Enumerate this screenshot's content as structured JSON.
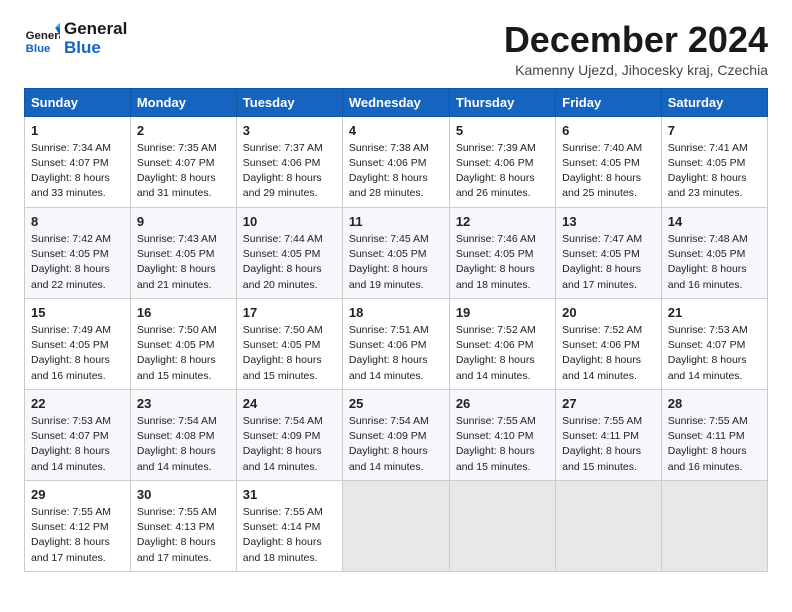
{
  "logo": {
    "line1": "General",
    "line2": "Blue"
  },
  "title": "December 2024",
  "subtitle": "Kamenny Ujezd, Jihocesky kraj, Czechia",
  "weekdays": [
    "Sunday",
    "Monday",
    "Tuesday",
    "Wednesday",
    "Thursday",
    "Friday",
    "Saturday"
  ],
  "weeks": [
    [
      {
        "day": 1,
        "sunrise": "Sunrise: 7:34 AM",
        "sunset": "Sunset: 4:07 PM",
        "daylight": "Daylight: 8 hours and 33 minutes."
      },
      {
        "day": 2,
        "sunrise": "Sunrise: 7:35 AM",
        "sunset": "Sunset: 4:07 PM",
        "daylight": "Daylight: 8 hours and 31 minutes."
      },
      {
        "day": 3,
        "sunrise": "Sunrise: 7:37 AM",
        "sunset": "Sunset: 4:06 PM",
        "daylight": "Daylight: 8 hours and 29 minutes."
      },
      {
        "day": 4,
        "sunrise": "Sunrise: 7:38 AM",
        "sunset": "Sunset: 4:06 PM",
        "daylight": "Daylight: 8 hours and 28 minutes."
      },
      {
        "day": 5,
        "sunrise": "Sunrise: 7:39 AM",
        "sunset": "Sunset: 4:06 PM",
        "daylight": "Daylight: 8 hours and 26 minutes."
      },
      {
        "day": 6,
        "sunrise": "Sunrise: 7:40 AM",
        "sunset": "Sunset: 4:05 PM",
        "daylight": "Daylight: 8 hours and 25 minutes."
      },
      {
        "day": 7,
        "sunrise": "Sunrise: 7:41 AM",
        "sunset": "Sunset: 4:05 PM",
        "daylight": "Daylight: 8 hours and 23 minutes."
      }
    ],
    [
      {
        "day": 8,
        "sunrise": "Sunrise: 7:42 AM",
        "sunset": "Sunset: 4:05 PM",
        "daylight": "Daylight: 8 hours and 22 minutes."
      },
      {
        "day": 9,
        "sunrise": "Sunrise: 7:43 AM",
        "sunset": "Sunset: 4:05 PM",
        "daylight": "Daylight: 8 hours and 21 minutes."
      },
      {
        "day": 10,
        "sunrise": "Sunrise: 7:44 AM",
        "sunset": "Sunset: 4:05 PM",
        "daylight": "Daylight: 8 hours and 20 minutes."
      },
      {
        "day": 11,
        "sunrise": "Sunrise: 7:45 AM",
        "sunset": "Sunset: 4:05 PM",
        "daylight": "Daylight: 8 hours and 19 minutes."
      },
      {
        "day": 12,
        "sunrise": "Sunrise: 7:46 AM",
        "sunset": "Sunset: 4:05 PM",
        "daylight": "Daylight: 8 hours and 18 minutes."
      },
      {
        "day": 13,
        "sunrise": "Sunrise: 7:47 AM",
        "sunset": "Sunset: 4:05 PM",
        "daylight": "Daylight: 8 hours and 17 minutes."
      },
      {
        "day": 14,
        "sunrise": "Sunrise: 7:48 AM",
        "sunset": "Sunset: 4:05 PM",
        "daylight": "Daylight: 8 hours and 16 minutes."
      }
    ],
    [
      {
        "day": 15,
        "sunrise": "Sunrise: 7:49 AM",
        "sunset": "Sunset: 4:05 PM",
        "daylight": "Daylight: 8 hours and 16 minutes."
      },
      {
        "day": 16,
        "sunrise": "Sunrise: 7:50 AM",
        "sunset": "Sunset: 4:05 PM",
        "daylight": "Daylight: 8 hours and 15 minutes."
      },
      {
        "day": 17,
        "sunrise": "Sunrise: 7:50 AM",
        "sunset": "Sunset: 4:05 PM",
        "daylight": "Daylight: 8 hours and 15 minutes."
      },
      {
        "day": 18,
        "sunrise": "Sunrise: 7:51 AM",
        "sunset": "Sunset: 4:06 PM",
        "daylight": "Daylight: 8 hours and 14 minutes."
      },
      {
        "day": 19,
        "sunrise": "Sunrise: 7:52 AM",
        "sunset": "Sunset: 4:06 PM",
        "daylight": "Daylight: 8 hours and 14 minutes."
      },
      {
        "day": 20,
        "sunrise": "Sunrise: 7:52 AM",
        "sunset": "Sunset: 4:06 PM",
        "daylight": "Daylight: 8 hours and 14 minutes."
      },
      {
        "day": 21,
        "sunrise": "Sunrise: 7:53 AM",
        "sunset": "Sunset: 4:07 PM",
        "daylight": "Daylight: 8 hours and 14 minutes."
      }
    ],
    [
      {
        "day": 22,
        "sunrise": "Sunrise: 7:53 AM",
        "sunset": "Sunset: 4:07 PM",
        "daylight": "Daylight: 8 hours and 14 minutes."
      },
      {
        "day": 23,
        "sunrise": "Sunrise: 7:54 AM",
        "sunset": "Sunset: 4:08 PM",
        "daylight": "Daylight: 8 hours and 14 minutes."
      },
      {
        "day": 24,
        "sunrise": "Sunrise: 7:54 AM",
        "sunset": "Sunset: 4:09 PM",
        "daylight": "Daylight: 8 hours and 14 minutes."
      },
      {
        "day": 25,
        "sunrise": "Sunrise: 7:54 AM",
        "sunset": "Sunset: 4:09 PM",
        "daylight": "Daylight: 8 hours and 14 minutes."
      },
      {
        "day": 26,
        "sunrise": "Sunrise: 7:55 AM",
        "sunset": "Sunset: 4:10 PM",
        "daylight": "Daylight: 8 hours and 15 minutes."
      },
      {
        "day": 27,
        "sunrise": "Sunrise: 7:55 AM",
        "sunset": "Sunset: 4:11 PM",
        "daylight": "Daylight: 8 hours and 15 minutes."
      },
      {
        "day": 28,
        "sunrise": "Sunrise: 7:55 AM",
        "sunset": "Sunset: 4:11 PM",
        "daylight": "Daylight: 8 hours and 16 minutes."
      }
    ],
    [
      {
        "day": 29,
        "sunrise": "Sunrise: 7:55 AM",
        "sunset": "Sunset: 4:12 PM",
        "daylight": "Daylight: 8 hours and 17 minutes."
      },
      {
        "day": 30,
        "sunrise": "Sunrise: 7:55 AM",
        "sunset": "Sunset: 4:13 PM",
        "daylight": "Daylight: 8 hours and 17 minutes."
      },
      {
        "day": 31,
        "sunrise": "Sunrise: 7:55 AM",
        "sunset": "Sunset: 4:14 PM",
        "daylight": "Daylight: 8 hours and 18 minutes."
      },
      null,
      null,
      null,
      null
    ]
  ]
}
